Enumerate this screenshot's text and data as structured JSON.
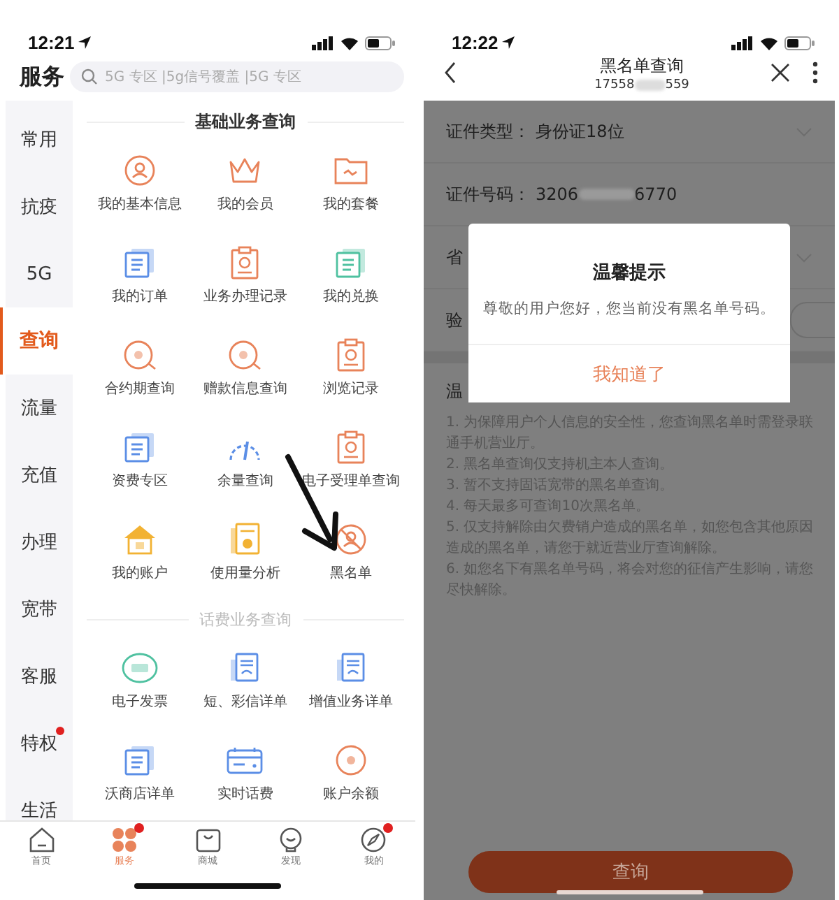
{
  "left_screen": {
    "status_bar": {
      "time": "12:21"
    },
    "title": "服务",
    "search": {
      "placeholder": "5G 专区 |5g信号覆盖 |5G 专区"
    },
    "sidebar": [
      {
        "label": "常用",
        "selected": false,
        "badge": false
      },
      {
        "label": "抗疫",
        "selected": false,
        "badge": false
      },
      {
        "label": "5G",
        "selected": false,
        "badge": false
      },
      {
        "label": "查询",
        "selected": true,
        "badge": false
      },
      {
        "label": "流量",
        "selected": false,
        "badge": false
      },
      {
        "label": "充值",
        "selected": false,
        "badge": false
      },
      {
        "label": "办理",
        "selected": false,
        "badge": false
      },
      {
        "label": "宽带",
        "selected": false,
        "badge": false
      },
      {
        "label": "客服",
        "selected": false,
        "badge": false
      },
      {
        "label": "特权",
        "selected": false,
        "badge": true
      },
      {
        "label": "生活",
        "selected": false,
        "badge": false
      }
    ],
    "sections": [
      {
        "title": "基础业务查询",
        "emphasized": true,
        "items": [
          "我的基本信息",
          "我的会员",
          "我的套餐",
          "我的订单",
          "业务办理记录",
          "我的兑换",
          "合约期查询",
          "赠款信息查询",
          "浏览记录",
          "资费专区",
          "余量查询",
          "电子受理单查询",
          "我的账户",
          "使用量分析",
          "黑名单"
        ]
      },
      {
        "title": "话费业务查询",
        "emphasized": false,
        "items": [
          "电子发票",
          "短、彩信详单",
          "增值业务详单",
          "沃商店详单",
          "实时话费",
          "账户余额"
        ]
      }
    ],
    "tab_bar": [
      {
        "label": "首页",
        "selected": false,
        "badge": false
      },
      {
        "label": "服务",
        "selected": true,
        "badge": true
      },
      {
        "label": "商城",
        "selected": false,
        "badge": false
      },
      {
        "label": "发现",
        "selected": false,
        "badge": false
      },
      {
        "label": "我的",
        "selected": false,
        "badge": true
      }
    ]
  },
  "right_screen": {
    "status_bar": {
      "time": "12:22"
    },
    "header": {
      "title": "黑名单查询",
      "subtitle_start": "17558",
      "subtitle_end": "559"
    },
    "form": [
      {
        "kind": "select",
        "label": "证件类型：",
        "value": "身份证18位"
      },
      {
        "kind": "masked",
        "label": "证件号码：",
        "value_start": "3206",
        "value_end": "6770"
      },
      {
        "kind": "select",
        "label": "省"
      },
      {
        "kind": "code",
        "label": "验"
      }
    ],
    "notes": {
      "title": "温",
      "items": [
        "1. 为保障用户个人信息的安全性，您查询黑名单时需登录联通手机营业厅。",
        "2. 黑名单查询仅支持机主本人查询。",
        "3. 暂不支持固话宽带的黑名单查询。",
        "4. 每天最多可查询10次黑名单。",
        "5. 仅支持解除由欠费销户造成的黑名单，如您包含其他原因造成的黑名单，请您于就近营业厅查询解除。",
        "6. 如您名下有黑名单号码，将会对您的征信产生影响，请您尽快解除。"
      ]
    },
    "dialog": {
      "title": "温馨提示",
      "message": "尊敬的用户您好，您当前没有黑名单号码。",
      "button": "我知道了"
    },
    "submit_button": "查询"
  }
}
